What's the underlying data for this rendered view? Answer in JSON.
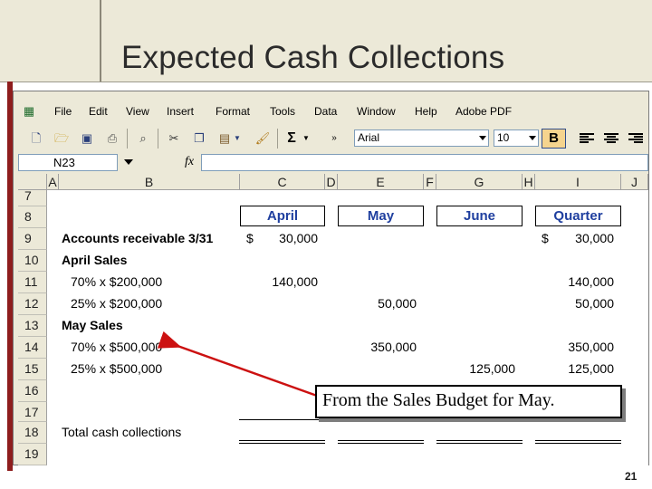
{
  "slide": {
    "title": "Expected Cash Collections",
    "page_number": "21"
  },
  "menu": [
    "File",
    "Edit",
    "View",
    "Insert",
    "Format",
    "Tools",
    "Data",
    "Window",
    "Help",
    "Adobe PDF"
  ],
  "toolbar": {
    "font_name": "Arial",
    "font_size": "10",
    "bold_label": "B",
    "sum_label": "Σ"
  },
  "formula_bar": {
    "name_box": "N23",
    "fx_label": "fx"
  },
  "columns": [
    "A",
    "B",
    "C",
    "D",
    "E",
    "F",
    "G",
    "H",
    "I",
    "J"
  ],
  "rows": [
    "7",
    "8",
    "9",
    "10",
    "11",
    "12",
    "13",
    "14",
    "15",
    "16",
    "17",
    "18",
    "19"
  ],
  "headers": {
    "april": "April",
    "may": "May",
    "june": "June",
    "quarter": "Quarter"
  },
  "labels": {
    "r9": "Accounts receivable 3/31",
    "r10": "April Sales",
    "r11": "70% x $200,000",
    "r12": "25% x $200,000",
    "r13": "May Sales",
    "r14": "70% x $500,000",
    "r15": "25% x $500,000",
    "r18": "Total cash collections"
  },
  "values": {
    "r9_dollar_c": "$",
    "r9_c": "30,000",
    "r9_dollar_i": "$",
    "r9_i": "30,000",
    "r11_c": "140,000",
    "r11_i": "140,000",
    "r12_e": "50,000",
    "r12_i": "50,000",
    "r14_e": "350,000",
    "r14_i": "350,000",
    "r15_g": "125,000",
    "r15_i": "125,000"
  },
  "callout": {
    "text": "From the Sales Budget for May."
  },
  "colors": {
    "header_text": "#1f3f9f",
    "arrow": "#cc1111",
    "accent_bar": "#8e1d1d"
  }
}
